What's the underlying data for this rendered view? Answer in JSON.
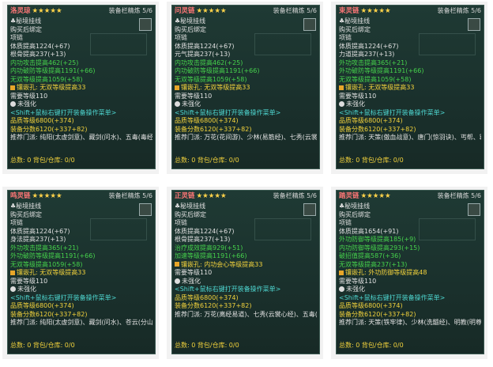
{
  "cards": [
    {
      "name": "洛灵琼",
      "stars": "★★★★★",
      "rank": "装备栏精炼 5/6",
      "lines": [
        {
          "t": "♣秘境挂线",
          "c": "w"
        },
        {
          "t": "购买后绑定",
          "c": "w"
        },
        {
          "t": "项链",
          "c": "w"
        },
        {
          "t": "体质提高1224(+67)",
          "c": "w"
        },
        {
          "t": "根骨提高237(+13)",
          "c": "w"
        },
        {
          "t": "内功攻击提高462(+25)",
          "c": "g"
        },
        {
          "t": "内功破防等级提高1191(+66)",
          "c": "g"
        },
        {
          "t": "无双等级提高1059(+58)",
          "c": "g"
        },
        {
          "t": "镶嵌孔: 无双等级提高33",
          "c": "y"
        },
        {
          "t": "需要等级110",
          "c": "w"
        },
        {
          "t": "未强化",
          "c": "w"
        },
        {
          "t": "<Shift+鼠标右键打开装备操作菜单>",
          "c": "c"
        },
        {
          "t": "品质等级6800(+374)",
          "c": "y"
        },
        {
          "t": "装备分数6120(+337+82)",
          "c": "y"
        },
        {
          "t": "推荐门派: 纯阳(太虚剑意)、藏剑(问水)、五毒(毒经)、长歌(莫问)、药宗(无方)",
          "c": "w"
        }
      ],
      "foot": "总数: 0   背包/仓库: 0/0"
    },
    {
      "name": "问灵链",
      "stars": "★★★★★",
      "rank": "装备栏精炼 5/6",
      "lines": [
        {
          "t": "♣秘境挂线",
          "c": "w"
        },
        {
          "t": "购买后绑定",
          "c": "w"
        },
        {
          "t": "项链",
          "c": "w"
        },
        {
          "t": "体质提高1224(+67)",
          "c": "w"
        },
        {
          "t": "元气提高237(+13)",
          "c": "w"
        },
        {
          "t": "内功攻击提高462(+25)",
          "c": "g"
        },
        {
          "t": "内功破防等级提高1191(+66)",
          "c": "g"
        },
        {
          "t": "无双等级提高1059(+58)",
          "c": "g"
        },
        {
          "t": "镶嵌孔: 无双等级提高33",
          "c": "y"
        },
        {
          "t": "需要等级110",
          "c": "w"
        },
        {
          "t": "未强化",
          "c": "w"
        },
        {
          "t": "<Shift+鼠标右键打开装备操作菜单>",
          "c": "c"
        },
        {
          "t": "品质等级6800(+374)",
          "c": "y"
        },
        {
          "t": "装备分数6120(+337+82)",
          "c": "y"
        },
        {
          "t": "推荐门派: 万花(花间游)、少林(易筋经)、七秀(云裳心经)、唐门(天罗诡道)、明教(焚影圣诀)、衍天宗",
          "c": "w"
        }
      ],
      "foot": "总数: 0   背包/仓库: 0/0"
    },
    {
      "name": "束灵链",
      "stars": "★★★★★",
      "rank": "装备栏精炼 5/6",
      "lines": [
        {
          "t": "♣秘境挂线",
          "c": "w"
        },
        {
          "t": "购买后绑定",
          "c": "w"
        },
        {
          "t": "项链",
          "c": "w"
        },
        {
          "t": "体质提高1224(+67)",
          "c": "w"
        },
        {
          "t": "力道提高237(+13)",
          "c": "w"
        },
        {
          "t": "外功攻击提高365(+21)",
          "c": "g"
        },
        {
          "t": "外功破防等级提高1191(+66)",
          "c": "g"
        },
        {
          "t": "无双等级提高1059(+58)",
          "c": "g"
        },
        {
          "t": "镶嵌孔: 无双等级提高33",
          "c": "y"
        },
        {
          "t": "需要等级110",
          "c": "w"
        },
        {
          "t": "未强化",
          "c": "w"
        },
        {
          "t": "<Shift+鼠标右键打开装备操作菜单>",
          "c": "c"
        },
        {
          "t": "品质等级6800(+374)",
          "c": "y"
        },
        {
          "t": "装备分数6120(+337+82)",
          "c": "y"
        },
        {
          "t": "推荐门派: 天策(傲血战意)、唐门(惊羽诀)、丐帮、霸刀",
          "c": "w"
        }
      ],
      "foot": "总数: 0   背包/仓库: 0/0"
    },
    {
      "name": "鸣灵链",
      "stars": "★★★★★",
      "rank": "装备栏精炼 5/6",
      "lines": [
        {
          "t": "♣秘境挂线",
          "c": "w"
        },
        {
          "t": "购买后绑定",
          "c": "w"
        },
        {
          "t": "项链",
          "c": "w"
        },
        {
          "t": "体质提高1224(+67)",
          "c": "w"
        },
        {
          "t": "身法提高237(+13)",
          "c": "w"
        },
        {
          "t": "外功攻击提高365(+21)",
          "c": "g"
        },
        {
          "t": "外功破防等级提高1191(+66)",
          "c": "g"
        },
        {
          "t": "无双等级提高1059(+58)",
          "c": "g"
        },
        {
          "t": "镶嵌孔: 无双等级提高33",
          "c": "y"
        },
        {
          "t": "需要等级110",
          "c": "w"
        },
        {
          "t": "未强化",
          "c": "w"
        },
        {
          "t": "<Shift+鼠标右键打开装备操作菜单>",
          "c": "c"
        },
        {
          "t": "品质等级6800(+374)",
          "c": "y"
        },
        {
          "t": "装备分数6120(+337+82)",
          "c": "y"
        },
        {
          "t": "推荐门派: 纯阳(太虚剑意)、藏剑(问水)、苍云(分山劲)、蓬莱、凌雪阁",
          "c": "w"
        }
      ],
      "foot": "总数: 0   背包/仓库: 0/0"
    },
    {
      "name": "正灵链",
      "stars": "★★★★★",
      "rank": "装备栏精炼 5/6",
      "lines": [
        {
          "t": "♣秘境挂线",
          "c": "w"
        },
        {
          "t": "购买后绑定",
          "c": "w"
        },
        {
          "t": "项链",
          "c": "w"
        },
        {
          "t": "体质提高1224(+67)",
          "c": "w"
        },
        {
          "t": "根骨提高237(+13)",
          "c": "w"
        },
        {
          "t": "治疗成效提高929(+51)",
          "c": "g"
        },
        {
          "t": "加速等级提高1191(+66)",
          "c": "g"
        },
        {
          "t": "镶嵌孔: 内功会心等级提高33",
          "c": "y"
        },
        {
          "t": "需要等级110",
          "c": "w"
        },
        {
          "t": "未强化",
          "c": "w"
        },
        {
          "t": "<Shift+鼠标右键打开装备操作菜单>",
          "c": "c"
        },
        {
          "t": "品质等级6800(+374)",
          "c": "y"
        },
        {
          "t": "装备分数6120(+337+82)",
          "c": "y"
        },
        {
          "t": "推荐门派: 万花(离经易道)、七秀(云裳心经)、五毒(补天诀)、长歌(相知)、药宗(灵素)",
          "c": "w"
        }
      ],
      "foot": "总数: 0   背包/仓库: 0/0"
    },
    {
      "name": "踏灵链",
      "stars": "★★★★★",
      "rank": "装备栏精炼 5/6",
      "lines": [
        {
          "t": "♣秘境挂线",
          "c": "w"
        },
        {
          "t": "购买后绑定",
          "c": "w"
        },
        {
          "t": "项链",
          "c": "w"
        },
        {
          "t": "体质提高1654(+91)",
          "c": "w"
        },
        {
          "t": "外功防御等级提高185(+9)",
          "c": "g"
        },
        {
          "t": "内功防御等级提高293(+15)",
          "c": "g"
        },
        {
          "t": "破招值提高587(+36)",
          "c": "g"
        },
        {
          "t": "无双等级提高237(+13)",
          "c": "g"
        },
        {
          "t": "镶嵌孔: 外功防御等级提高48",
          "c": "y"
        },
        {
          "t": "需要等级110",
          "c": "w"
        },
        {
          "t": "未强化",
          "c": "w"
        },
        {
          "t": "<Shift+鼠标右键打开装备操作菜单>",
          "c": "c"
        },
        {
          "t": "品质等级6800(+374)",
          "c": "y"
        },
        {
          "t": "装备分数6120(+337+82)",
          "c": "y"
        },
        {
          "t": "推荐门派: 天策(铁牢律)、少林(洗髓经)、明教(明尊琉璃体)、苍云(铁骨衣)",
          "c": "w"
        }
      ],
      "foot": "总数: 0   背包/仓库: 0/0"
    }
  ]
}
